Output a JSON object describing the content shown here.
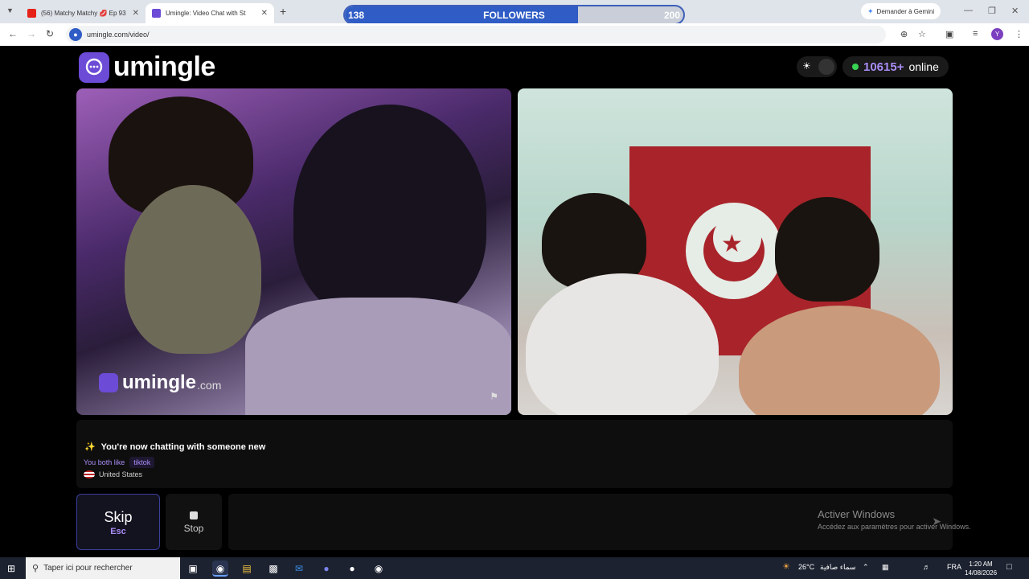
{
  "browser": {
    "tabs": [
      {
        "title": "(56) Matchy Matchy 💋 Ep 93",
        "favicon_color": "#e62117"
      },
      {
        "title": "Umingle: Video Chat with St",
        "favicon_color": "#6c4bd6"
      }
    ],
    "new_tab": "+",
    "gemini_label": "Demander à Gemini",
    "url": "umingle.com/video/",
    "profile_initial": "Y"
  },
  "followers": {
    "current": "138",
    "label": "FOLLOWERS",
    "goal": "200",
    "progress": 0.69
  },
  "page": {
    "logo_text": "umingle",
    "online_count": "10615+",
    "online_label": "online",
    "watermark_name": "umingle",
    "watermark_domain": ".com"
  },
  "chat": {
    "message": "You're now chatting with someone new",
    "shared_prefix": "You both like",
    "shared_interest": "tiktok",
    "country": "United States"
  },
  "controls": {
    "skip_label": "Skip",
    "skip_key": "Esc",
    "stop_label": "Stop"
  },
  "windows_activation": {
    "title": "Activer Windows",
    "subtitle": "Accédez aux paramètres pour activer Windows."
  },
  "taskbar": {
    "search_placeholder": "Taper ici pour rechercher",
    "weather_temp": "26°C",
    "weather_text": "سماء صافية",
    "language": "FRA",
    "time": "1:20 AM",
    "date": "14/08/2026"
  },
  "colors": {
    "brand": "#6c4bd6",
    "accent_text": "#a98cf5",
    "online_dot": "#39d353"
  }
}
